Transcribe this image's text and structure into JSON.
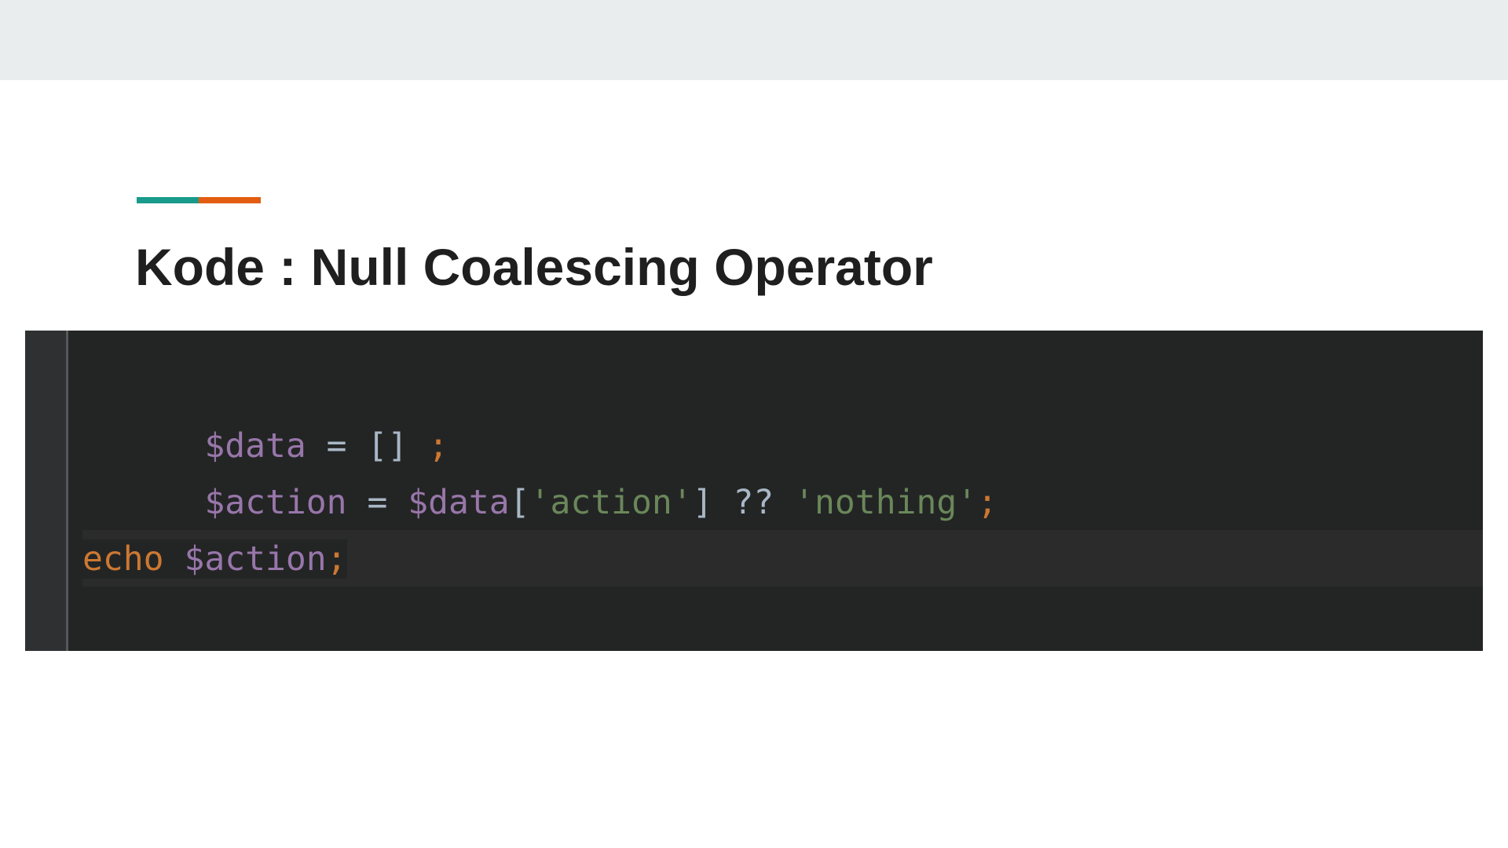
{
  "slide": {
    "title": "Kode : Null Coalescing Operator",
    "accent_colors": [
      "#1a9a8b",
      "#e35d10"
    ]
  },
  "editor": {
    "background": "#232525",
    "lines": [
      {
        "tokens": [
          {
            "text": "$data",
            "kind": "variable"
          },
          {
            "text": " = [] ",
            "kind": "plain"
          },
          {
            "text": ";",
            "kind": "keyword"
          }
        ]
      },
      {
        "tokens": [
          {
            "text": "$action",
            "kind": "variable"
          },
          {
            "text": " = ",
            "kind": "plain"
          },
          {
            "text": "$data",
            "kind": "variable"
          },
          {
            "text": "[",
            "kind": "plain"
          },
          {
            "text": "'action'",
            "kind": "string"
          },
          {
            "text": "] ?? ",
            "kind": "plain"
          },
          {
            "text": "'nothing'",
            "kind": "string"
          },
          {
            "text": ";",
            "kind": "keyword"
          }
        ]
      },
      {
        "tokens": []
      },
      {
        "tokens": [
          {
            "text": "echo",
            "kind": "keyword"
          },
          {
            "text": " ",
            "kind": "plain"
          },
          {
            "text": "$action",
            "kind": "variable"
          },
          {
            "text": ";",
            "kind": "plain"
          }
        ]
      }
    ],
    "syntax_colors": {
      "variable": "#9876aa",
      "plain": "#a9b7c6",
      "string": "#6a8759",
      "keyword": "#cc7832"
    }
  }
}
